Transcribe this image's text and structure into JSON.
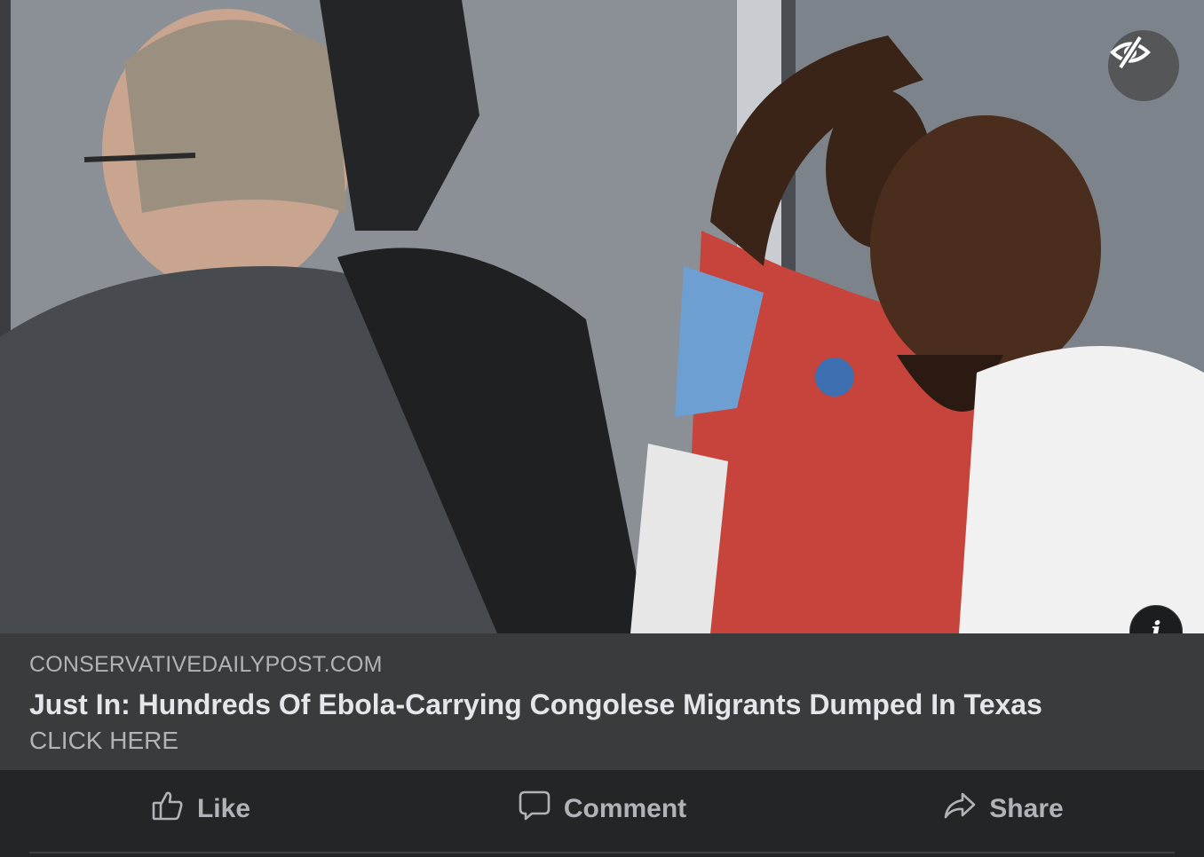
{
  "post": {
    "image_alt": "News photo of a group of men standing indoors",
    "hide_icon": "eye-slash-icon",
    "info_icon": "info-icon",
    "info_glyph": "i"
  },
  "link_preview": {
    "domain": "CONSERVATIVEDAILYPOST.COM",
    "headline": "Just In: Hundreds Of Ebola-Carrying Congolese Migrants Dumped In Texas",
    "cta": "CLICK HERE"
  },
  "actions": [
    {
      "label": "Like",
      "icon": "thumbs-up-icon"
    },
    {
      "label": "Comment",
      "icon": "comment-bubble-icon"
    },
    {
      "label": "Share",
      "icon": "share-arrow-icon"
    }
  ],
  "colors": {
    "background": "#242526",
    "card": "#3a3b3c",
    "primary_text": "#e4e6eb",
    "secondary_text": "#b0b3b8"
  }
}
